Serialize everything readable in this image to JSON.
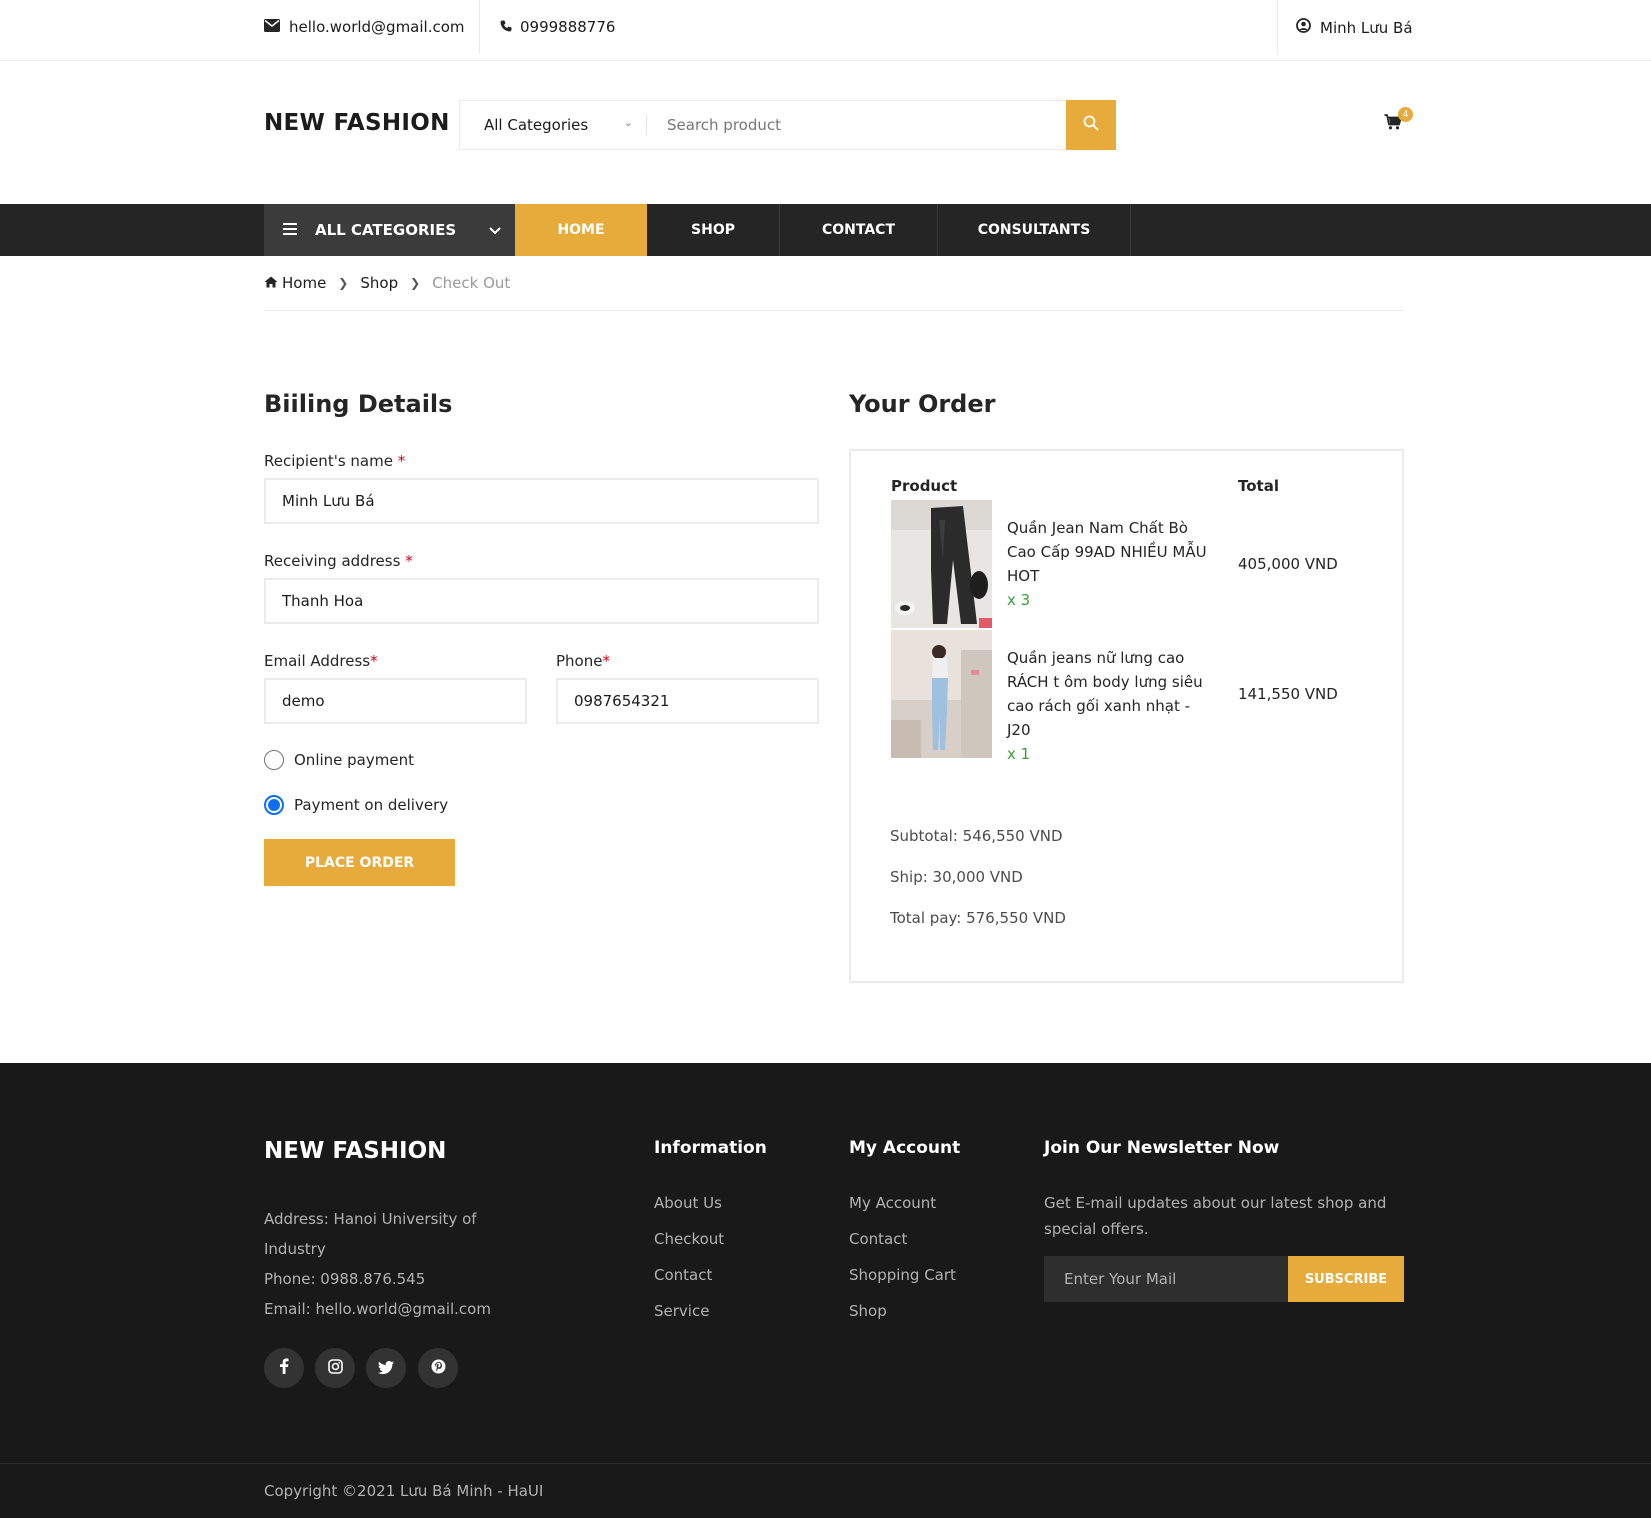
{
  "topbar": {
    "email": "hello.world@gmail.com",
    "phone": "0999888776",
    "user": "Minh Lưu Bá"
  },
  "header": {
    "logo": "NEW FASHION",
    "category_select": "All Categories",
    "search_placeholder": "Search product",
    "cart_count": "4"
  },
  "nav": {
    "all_categories": "ALL CATEGORIES",
    "items": [
      "HOME",
      "SHOP",
      "CONTACT",
      "CONSULTANTS"
    ]
  },
  "breadcrumb": [
    "Home",
    "Shop",
    "Check Out"
  ],
  "billing": {
    "title": "Biiling Details",
    "name_label": "Recipient's name",
    "name_value": "Minh Lưu Bá",
    "address_label": "Receiving address",
    "address_value": "Thanh Hoa",
    "email_label": "Email Address",
    "email_value": "demo",
    "phone_label": "Phone",
    "phone_value": "0987654321",
    "required_mark": "*",
    "payment_online": "Online payment",
    "payment_delivery": "Payment on delivery",
    "place_order": "PLACE ORDER"
  },
  "order": {
    "title": "Your Order",
    "col_product": "Product",
    "col_total": "Total",
    "items": [
      {
        "name": "Quần Jean Nam Chất Bò Cao Cấp 99AD NHIỀU MẪU HOT",
        "qty": "x 3",
        "total": "405,000 VND"
      },
      {
        "name": "Quần jeans nữ lưng cao RÁCH t ôm body lưng siêu cao rách gối xanh nhạt - J20",
        "qty": "x 1",
        "total": "141,550 VND"
      }
    ],
    "subtotal": "Subtotal: 546,550 VND",
    "ship": "Ship: 30,000 VND",
    "total_pay": "Total pay: 576,550 VND"
  },
  "footer": {
    "logo": "NEW FASHION",
    "address_line1": "Address: Hanoi University of",
    "address_line2": "Industry",
    "phone": "Phone: 0988.876.545",
    "email": "Email: hello.world@gmail.com",
    "info_title": "Information",
    "info_links": [
      "About Us",
      "Checkout",
      "Contact",
      "Service"
    ],
    "account_title": "My Account",
    "account_links": [
      "My Account",
      "Contact",
      "Shopping Cart",
      "Shop"
    ],
    "newsletter_title": "Join Our Newsletter Now",
    "newsletter_text": "Get E-mail updates about our latest shop and special offers.",
    "newsletter_placeholder": "Enter Your Mail",
    "subscribe": "SUBSCRIBE",
    "copyright": "Copyright ©2021 Lưu Bá Minh - HaUI"
  },
  "colors": {
    "accent": "#e7ab3c",
    "nav_bg": "#252525",
    "footer_bg": "#191919"
  }
}
